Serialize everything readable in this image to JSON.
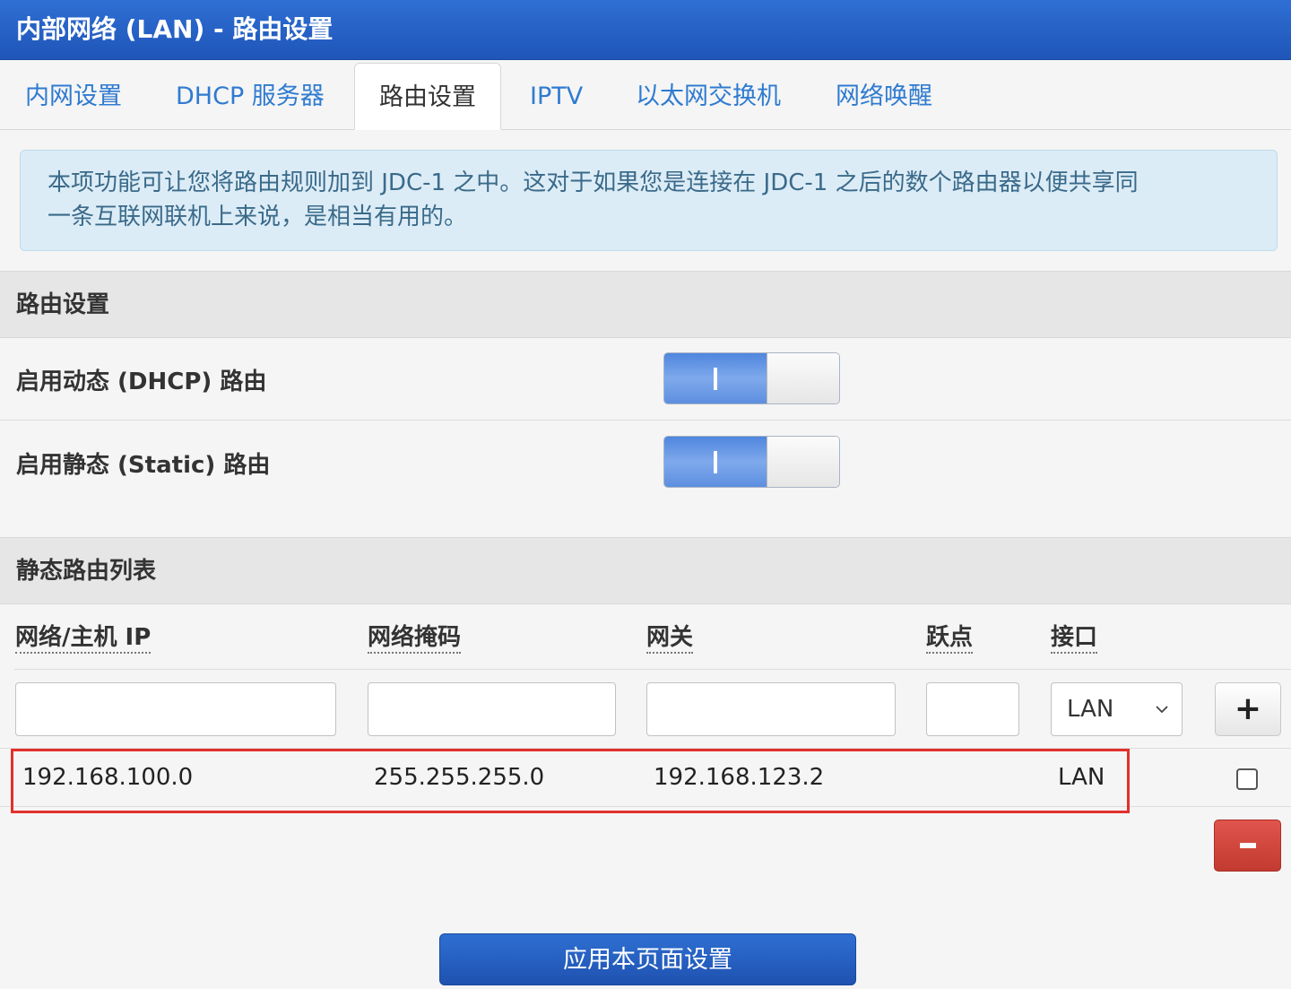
{
  "window": {
    "title": "内部网络 (LAN) - 路由设置"
  },
  "tabs": [
    {
      "label": "内网设置"
    },
    {
      "label": "DHCP 服务器"
    },
    {
      "label": "路由设置",
      "active": true
    },
    {
      "label": "IPTV"
    },
    {
      "label": "以太网交换机"
    },
    {
      "label": "网络唤醒"
    }
  ],
  "info": {
    "line1": "本项功能可让您将路由规则加到 JDC-1 之中。这对于如果您是连接在 JDC-1 之后的数个路由器以便共享同",
    "line2": "一条互联网联机上来说，是相当有用的。"
  },
  "routing_settings": {
    "header": "路由设置",
    "dhcp_route_label": "启用动态 (DHCP) 路由",
    "dhcp_route_enabled": true,
    "static_route_label": "启用静态 (Static) 路由",
    "static_route_enabled": true,
    "toggle_on_glyph": "I"
  },
  "static_routes": {
    "header": "静态路由列表",
    "columns": {
      "ip": "网络/主机 IP",
      "netmask": "网络掩码",
      "gateway": "网关",
      "metric": "跃点",
      "interface": "接口"
    },
    "new_row": {
      "ip": "",
      "netmask": "",
      "gateway": "",
      "metric": "",
      "interface": "LAN"
    },
    "add_label": "+",
    "rows": [
      {
        "ip": "192.168.100.0",
        "netmask": "255.255.255.0",
        "gateway": "192.168.123.2",
        "metric": "",
        "interface": "LAN",
        "checked": false
      }
    ]
  },
  "apply_label": "应用本页面设置",
  "colors": {
    "primary": "#2a64c8",
    "link": "#2f7bd0",
    "danger": "#d0423a",
    "highlight": "#e2302c",
    "info_bg": "#dcecf6"
  },
  "icons": [
    "plus-icon",
    "minus-icon",
    "chevron-down-icon"
  ]
}
